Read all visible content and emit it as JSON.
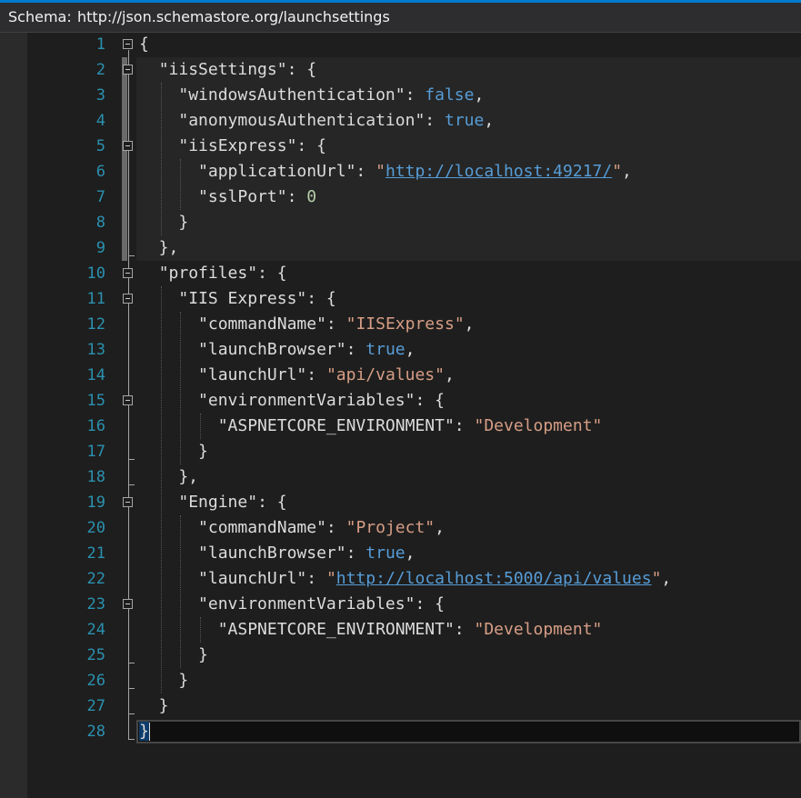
{
  "schema_bar": {
    "label": "Schema:",
    "url": "http://json.schemastore.org/launchsettings"
  },
  "editor": {
    "line_numbers": [
      "1",
      "2",
      "3",
      "4",
      "5",
      "6",
      "7",
      "8",
      "9",
      "10",
      "11",
      "12",
      "13",
      "14",
      "15",
      "16",
      "17",
      "18",
      "19",
      "20",
      "21",
      "22",
      "23",
      "24",
      "25",
      "26",
      "27",
      "28"
    ],
    "lines": [
      [
        {
          "t": "{",
          "c": "punc"
        }
      ],
      [
        {
          "t": "  ",
          "c": "punc"
        },
        {
          "t": "\"iisSettings\"",
          "c": "key"
        },
        {
          "t": ": {",
          "c": "punc"
        }
      ],
      [
        {
          "t": "    ",
          "c": "punc"
        },
        {
          "t": "\"windowsAuthentication\"",
          "c": "key"
        },
        {
          "t": ": ",
          "c": "punc"
        },
        {
          "t": "false",
          "c": "kw"
        },
        {
          "t": ",",
          "c": "punc"
        }
      ],
      [
        {
          "t": "    ",
          "c": "punc"
        },
        {
          "t": "\"anonymousAuthentication\"",
          "c": "key"
        },
        {
          "t": ": ",
          "c": "punc"
        },
        {
          "t": "true",
          "c": "kw"
        },
        {
          "t": ",",
          "c": "punc"
        }
      ],
      [
        {
          "t": "    ",
          "c": "punc"
        },
        {
          "t": "\"iisExpress\"",
          "c": "key"
        },
        {
          "t": ": {",
          "c": "punc"
        }
      ],
      [
        {
          "t": "      ",
          "c": "punc"
        },
        {
          "t": "\"applicationUrl\"",
          "c": "key"
        },
        {
          "t": ": ",
          "c": "punc"
        },
        {
          "t": "\"",
          "c": "str"
        },
        {
          "t": "http://localhost:49217/",
          "c": "url"
        },
        {
          "t": "\"",
          "c": "str"
        },
        {
          "t": ",",
          "c": "punc"
        }
      ],
      [
        {
          "t": "      ",
          "c": "punc"
        },
        {
          "t": "\"sslPort\"",
          "c": "key"
        },
        {
          "t": ": ",
          "c": "punc"
        },
        {
          "t": "0",
          "c": "num"
        }
      ],
      [
        {
          "t": "    }",
          "c": "punc"
        }
      ],
      [
        {
          "t": "  },",
          "c": "punc"
        }
      ],
      [
        {
          "t": "  ",
          "c": "punc"
        },
        {
          "t": "\"profiles\"",
          "c": "key"
        },
        {
          "t": ": {",
          "c": "punc"
        }
      ],
      [
        {
          "t": "    ",
          "c": "punc"
        },
        {
          "t": "\"IIS Express\"",
          "c": "key"
        },
        {
          "t": ": {",
          "c": "punc"
        }
      ],
      [
        {
          "t": "      ",
          "c": "punc"
        },
        {
          "t": "\"commandName\"",
          "c": "key"
        },
        {
          "t": ": ",
          "c": "punc"
        },
        {
          "t": "\"IISExpress\"",
          "c": "str"
        },
        {
          "t": ",",
          "c": "punc"
        }
      ],
      [
        {
          "t": "      ",
          "c": "punc"
        },
        {
          "t": "\"launchBrowser\"",
          "c": "key"
        },
        {
          "t": ": ",
          "c": "punc"
        },
        {
          "t": "true",
          "c": "kw"
        },
        {
          "t": ",",
          "c": "punc"
        }
      ],
      [
        {
          "t": "      ",
          "c": "punc"
        },
        {
          "t": "\"launchUrl\"",
          "c": "key"
        },
        {
          "t": ": ",
          "c": "punc"
        },
        {
          "t": "\"api/values\"",
          "c": "str"
        },
        {
          "t": ",",
          "c": "punc"
        }
      ],
      [
        {
          "t": "      ",
          "c": "punc"
        },
        {
          "t": "\"environmentVariables\"",
          "c": "key"
        },
        {
          "t": ": {",
          "c": "punc"
        }
      ],
      [
        {
          "t": "        ",
          "c": "punc"
        },
        {
          "t": "\"ASPNETCORE_ENVIRONMENT\"",
          "c": "key"
        },
        {
          "t": ": ",
          "c": "punc"
        },
        {
          "t": "\"Development\"",
          "c": "str"
        }
      ],
      [
        {
          "t": "      }",
          "c": "punc"
        }
      ],
      [
        {
          "t": "    },",
          "c": "punc"
        }
      ],
      [
        {
          "t": "    ",
          "c": "punc"
        },
        {
          "t": "\"Engine\"",
          "c": "key"
        },
        {
          "t": ": {",
          "c": "punc"
        }
      ],
      [
        {
          "t": "      ",
          "c": "punc"
        },
        {
          "t": "\"commandName\"",
          "c": "key"
        },
        {
          "t": ": ",
          "c": "punc"
        },
        {
          "t": "\"Project\"",
          "c": "str"
        },
        {
          "t": ",",
          "c": "punc"
        }
      ],
      [
        {
          "t": "      ",
          "c": "punc"
        },
        {
          "t": "\"launchBrowser\"",
          "c": "key"
        },
        {
          "t": ": ",
          "c": "punc"
        },
        {
          "t": "true",
          "c": "kw"
        },
        {
          "t": ",",
          "c": "punc"
        }
      ],
      [
        {
          "t": "      ",
          "c": "punc"
        },
        {
          "t": "\"launchUrl\"",
          "c": "key"
        },
        {
          "t": ": ",
          "c": "punc"
        },
        {
          "t": "\"",
          "c": "str"
        },
        {
          "t": "http://localhost:5000/api/values",
          "c": "url"
        },
        {
          "t": "\"",
          "c": "str"
        },
        {
          "t": ",",
          "c": "punc"
        }
      ],
      [
        {
          "t": "      ",
          "c": "punc"
        },
        {
          "t": "\"environmentVariables\"",
          "c": "key"
        },
        {
          "t": ": {",
          "c": "punc"
        }
      ],
      [
        {
          "t": "        ",
          "c": "punc"
        },
        {
          "t": "\"ASPNETCORE_ENVIRONMENT\"",
          "c": "key"
        },
        {
          "t": ": ",
          "c": "punc"
        },
        {
          "t": "\"Development\"",
          "c": "str"
        }
      ],
      [
        {
          "t": "      }",
          "c": "punc"
        }
      ],
      [
        {
          "t": "    }",
          "c": "punc"
        }
      ],
      [
        {
          "t": "  }",
          "c": "punc"
        }
      ],
      [
        {
          "t": "}",
          "c": "brace-hl"
        }
      ]
    ],
    "current_line": 28,
    "collapsible_lines": [
      1,
      2,
      5,
      10,
      11,
      15,
      19,
      23
    ],
    "changed_lines": [
      2,
      3,
      4,
      5,
      6,
      7,
      8,
      9
    ],
    "colors": {
      "line_number": "#2b91af",
      "string": "#d69d85",
      "keyword": "#569cd6",
      "number": "#b5cea8",
      "text": "#dcdcdc",
      "background": "#1e1e1e",
      "accent": "#007acc"
    }
  }
}
